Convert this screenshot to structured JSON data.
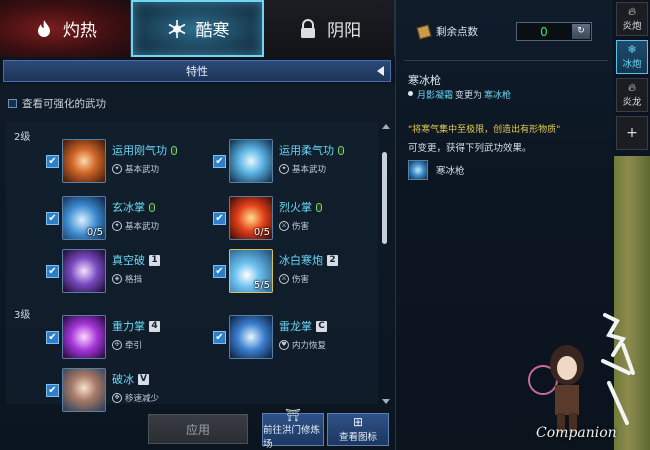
{
  "tabs": [
    {
      "label": "灼热",
      "icon": "flame-icon",
      "active": false
    },
    {
      "label": "酷寒",
      "icon": "snowflake-icon",
      "active": true
    },
    {
      "label": "阴阳",
      "icon": "lock-icon",
      "active": false
    }
  ],
  "trait_header": "特性",
  "show_upgradable": "查看可强化的武功",
  "levels": [
    "2级",
    "3级"
  ],
  "skills": [
    {
      "name": "运用刚气功",
      "badge": "",
      "mouse": true,
      "count": "",
      "sub": "基本武功"
    },
    {
      "name": "运用柔气功",
      "badge": "",
      "mouse": true,
      "count": "",
      "sub": "基本武功"
    },
    {
      "name": "玄冰掌",
      "badge": "",
      "mouse": true,
      "count": "0/5",
      "sub": "基本武功"
    },
    {
      "name": "烈火掌",
      "badge": "",
      "mouse": true,
      "count": "0/5",
      "sub": "伤害"
    },
    {
      "name": "真空破",
      "badge": "1",
      "mouse": false,
      "count": "",
      "sub": "格挡"
    },
    {
      "name": "冰白寒炮",
      "badge": "2",
      "mouse": false,
      "count": "5/5",
      "sub": "伤害"
    },
    {
      "name": "重力掌",
      "badge": "4",
      "mouse": false,
      "count": "",
      "sub": "牵引"
    },
    {
      "name": "雷龙掌",
      "badge": "C",
      "mouse": false,
      "count": "",
      "sub": "内力恢复"
    },
    {
      "name": "破冰",
      "badge": "V",
      "mouse": false,
      "count": "",
      "sub": "移速减少"
    }
  ],
  "buttons": {
    "apply": "应用",
    "go_training": "前往洪门修炼场",
    "view_icons": "查看图标"
  },
  "right": {
    "points_label": "剩余点数",
    "points_value": "0",
    "title": "寒冰枪",
    "line_a": "月影凝霜",
    "line_b": "变更为",
    "line_c": "寒冰枪",
    "quote": "\"将寒气集中至极限，创造出有形物质\"",
    "desc": "可变更，获得下列武功效果。",
    "item": "寒冰枪"
  },
  "side_tabs": [
    {
      "label": "炎炮",
      "icon": "flame-icon",
      "active": false
    },
    {
      "label": "冰炮",
      "icon": "snowflake-icon",
      "active": true
    },
    {
      "label": "炎龙",
      "icon": "flame-icon",
      "active": false
    },
    {
      "label": "+",
      "icon": "plus-icon",
      "active": false
    }
  ],
  "watermark": "Companion",
  "colors": {
    "accent": "#6ad6f5",
    "points": "#35e06a",
    "quote": "#e6c94e",
    "button": "#2e5288"
  }
}
